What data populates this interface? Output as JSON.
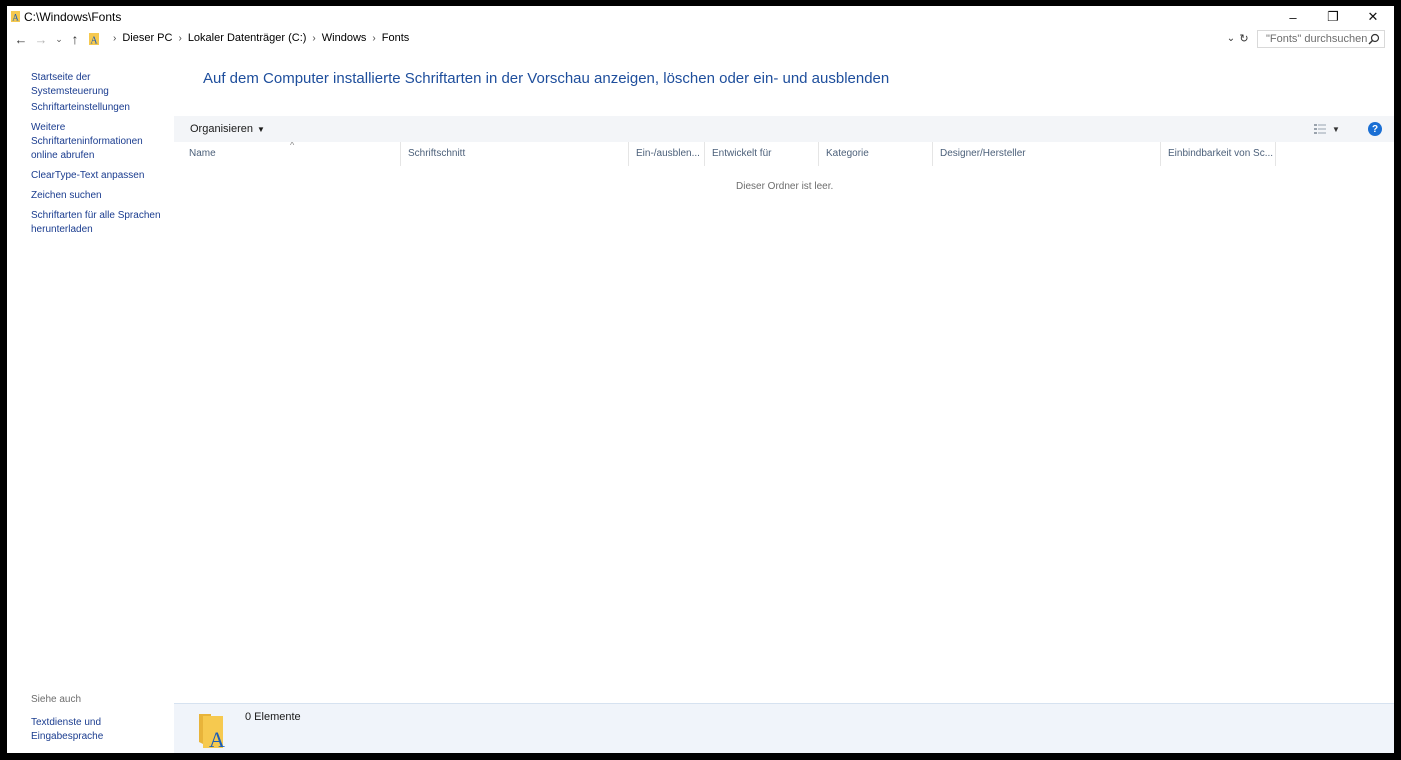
{
  "window": {
    "title": "C:\\Windows\\Fonts",
    "controls": {
      "minimize": "–",
      "maximize": "❐",
      "close": "✕"
    }
  },
  "nav": {
    "back": "←",
    "forward": "→",
    "recent": "⌄",
    "up": "↑",
    "breadcrumbs": [
      "Dieser PC",
      "Lokaler Datenträger (C:)",
      "Windows",
      "Fonts"
    ],
    "breadcrumb_separator": "›",
    "dropdown": "⌄",
    "refresh": "↻",
    "search_placeholder": "\"Fonts\" durchsuchen"
  },
  "sidebar": {
    "links": [
      "Startseite der Systemsteuerung",
      "Schriftarteinstellungen",
      "Weitere Schriftarteninformationen online abrufen",
      "ClearType-Text anpassen",
      "Zeichen suchen",
      "Schriftarten für alle Sprachen herunterladen"
    ],
    "see_also_label": "Siehe auch",
    "see_also_links": [
      "Textdienste und Eingabesprache"
    ]
  },
  "main": {
    "heading": "Auf dem Computer installierte Schriftarten in der Vorschau anzeigen, löschen oder ein- und ausblenden",
    "toolbar": {
      "organize": "Organisieren",
      "help": "?"
    },
    "columns": [
      "Name",
      "Schriftschnitt",
      "Ein-/ausblen...",
      "Entwickelt für",
      "Kategorie",
      "Designer/Hersteller",
      "Einbindbarkeit von Sc..."
    ],
    "sort_indicator": "^",
    "empty_message": "Dieser Ordner ist leer."
  },
  "details": {
    "count": "0 Elemente"
  },
  "colors": {
    "link": "#1a3c8f",
    "heading": "#1e4e9c",
    "toolbar_bg": "#f3f5f8",
    "details_bg": "#f0f4fa",
    "help_button": "#1a6fd4",
    "folder_yellow": "#f6c94f",
    "font_letter_blue": "#1e5eb5"
  }
}
